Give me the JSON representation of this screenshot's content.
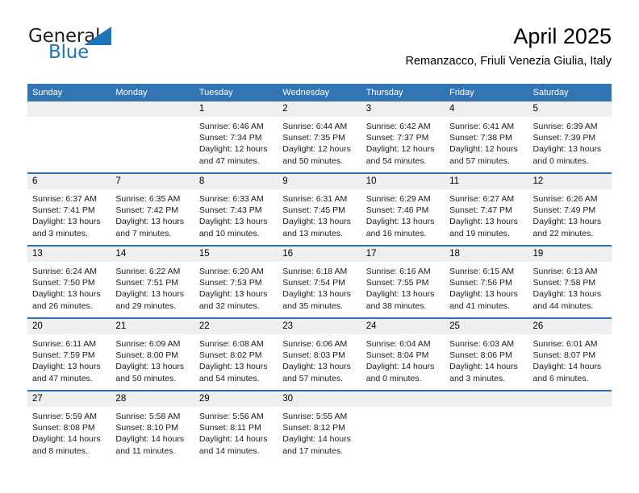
{
  "brand": {
    "name_top": "General",
    "name_bottom": "Blue",
    "triangle_icon": "brand-triangle-icon",
    "color_dark": "#231f20",
    "color_blue": "#1b76bc"
  },
  "header": {
    "title": "April 2025",
    "subtitle": "Remanzacco, Friuli Venezia Giulia, Italy"
  },
  "theme": {
    "header_blue": "#3175b4",
    "row_divider": "#2f6fae",
    "daynum_band": "#efefef",
    "cell_bg": "#ffffff"
  },
  "weekdays": [
    "Sunday",
    "Monday",
    "Tuesday",
    "Wednesday",
    "Thursday",
    "Friday",
    "Saturday"
  ],
  "weeks": [
    [
      {
        "day": "",
        "empty": true
      },
      {
        "day": "",
        "empty": true
      },
      {
        "day": "1",
        "sunrise": "Sunrise: 6:46 AM",
        "sunset": "Sunset: 7:34 PM",
        "daylight_l1": "Daylight: 12 hours",
        "daylight_l2": "and 47 minutes."
      },
      {
        "day": "2",
        "sunrise": "Sunrise: 6:44 AM",
        "sunset": "Sunset: 7:35 PM",
        "daylight_l1": "Daylight: 12 hours",
        "daylight_l2": "and 50 minutes."
      },
      {
        "day": "3",
        "sunrise": "Sunrise: 6:42 AM",
        "sunset": "Sunset: 7:37 PM",
        "daylight_l1": "Daylight: 12 hours",
        "daylight_l2": "and 54 minutes."
      },
      {
        "day": "4",
        "sunrise": "Sunrise: 6:41 AM",
        "sunset": "Sunset: 7:38 PM",
        "daylight_l1": "Daylight: 12 hours",
        "daylight_l2": "and 57 minutes."
      },
      {
        "day": "5",
        "sunrise": "Sunrise: 6:39 AM",
        "sunset": "Sunset: 7:39 PM",
        "daylight_l1": "Daylight: 13 hours",
        "daylight_l2": "and 0 minutes."
      }
    ],
    [
      {
        "day": "6",
        "sunrise": "Sunrise: 6:37 AM",
        "sunset": "Sunset: 7:41 PM",
        "daylight_l1": "Daylight: 13 hours",
        "daylight_l2": "and 3 minutes."
      },
      {
        "day": "7",
        "sunrise": "Sunrise: 6:35 AM",
        "sunset": "Sunset: 7:42 PM",
        "daylight_l1": "Daylight: 13 hours",
        "daylight_l2": "and 7 minutes."
      },
      {
        "day": "8",
        "sunrise": "Sunrise: 6:33 AM",
        "sunset": "Sunset: 7:43 PM",
        "daylight_l1": "Daylight: 13 hours",
        "daylight_l2": "and 10 minutes."
      },
      {
        "day": "9",
        "sunrise": "Sunrise: 6:31 AM",
        "sunset": "Sunset: 7:45 PM",
        "daylight_l1": "Daylight: 13 hours",
        "daylight_l2": "and 13 minutes."
      },
      {
        "day": "10",
        "sunrise": "Sunrise: 6:29 AM",
        "sunset": "Sunset: 7:46 PM",
        "daylight_l1": "Daylight: 13 hours",
        "daylight_l2": "and 16 minutes."
      },
      {
        "day": "11",
        "sunrise": "Sunrise: 6:27 AM",
        "sunset": "Sunset: 7:47 PM",
        "daylight_l1": "Daylight: 13 hours",
        "daylight_l2": "and 19 minutes."
      },
      {
        "day": "12",
        "sunrise": "Sunrise: 6:26 AM",
        "sunset": "Sunset: 7:49 PM",
        "daylight_l1": "Daylight: 13 hours",
        "daylight_l2": "and 22 minutes."
      }
    ],
    [
      {
        "day": "13",
        "sunrise": "Sunrise: 6:24 AM",
        "sunset": "Sunset: 7:50 PM",
        "daylight_l1": "Daylight: 13 hours",
        "daylight_l2": "and 26 minutes."
      },
      {
        "day": "14",
        "sunrise": "Sunrise: 6:22 AM",
        "sunset": "Sunset: 7:51 PM",
        "daylight_l1": "Daylight: 13 hours",
        "daylight_l2": "and 29 minutes."
      },
      {
        "day": "15",
        "sunrise": "Sunrise: 6:20 AM",
        "sunset": "Sunset: 7:53 PM",
        "daylight_l1": "Daylight: 13 hours",
        "daylight_l2": "and 32 minutes."
      },
      {
        "day": "16",
        "sunrise": "Sunrise: 6:18 AM",
        "sunset": "Sunset: 7:54 PM",
        "daylight_l1": "Daylight: 13 hours",
        "daylight_l2": "and 35 minutes."
      },
      {
        "day": "17",
        "sunrise": "Sunrise: 6:16 AM",
        "sunset": "Sunset: 7:55 PM",
        "daylight_l1": "Daylight: 13 hours",
        "daylight_l2": "and 38 minutes."
      },
      {
        "day": "18",
        "sunrise": "Sunrise: 6:15 AM",
        "sunset": "Sunset: 7:56 PM",
        "daylight_l1": "Daylight: 13 hours",
        "daylight_l2": "and 41 minutes."
      },
      {
        "day": "19",
        "sunrise": "Sunrise: 6:13 AM",
        "sunset": "Sunset: 7:58 PM",
        "daylight_l1": "Daylight: 13 hours",
        "daylight_l2": "and 44 minutes."
      }
    ],
    [
      {
        "day": "20",
        "sunrise": "Sunrise: 6:11 AM",
        "sunset": "Sunset: 7:59 PM",
        "daylight_l1": "Daylight: 13 hours",
        "daylight_l2": "and 47 minutes."
      },
      {
        "day": "21",
        "sunrise": "Sunrise: 6:09 AM",
        "sunset": "Sunset: 8:00 PM",
        "daylight_l1": "Daylight: 13 hours",
        "daylight_l2": "and 50 minutes."
      },
      {
        "day": "22",
        "sunrise": "Sunrise: 6:08 AM",
        "sunset": "Sunset: 8:02 PM",
        "daylight_l1": "Daylight: 13 hours",
        "daylight_l2": "and 54 minutes."
      },
      {
        "day": "23",
        "sunrise": "Sunrise: 6:06 AM",
        "sunset": "Sunset: 8:03 PM",
        "daylight_l1": "Daylight: 13 hours",
        "daylight_l2": "and 57 minutes."
      },
      {
        "day": "24",
        "sunrise": "Sunrise: 6:04 AM",
        "sunset": "Sunset: 8:04 PM",
        "daylight_l1": "Daylight: 14 hours",
        "daylight_l2": "and 0 minutes."
      },
      {
        "day": "25",
        "sunrise": "Sunrise: 6:03 AM",
        "sunset": "Sunset: 8:06 PM",
        "daylight_l1": "Daylight: 14 hours",
        "daylight_l2": "and 3 minutes."
      },
      {
        "day": "26",
        "sunrise": "Sunrise: 6:01 AM",
        "sunset": "Sunset: 8:07 PM",
        "daylight_l1": "Daylight: 14 hours",
        "daylight_l2": "and 6 minutes."
      }
    ],
    [
      {
        "day": "27",
        "sunrise": "Sunrise: 5:59 AM",
        "sunset": "Sunset: 8:08 PM",
        "daylight_l1": "Daylight: 14 hours",
        "daylight_l2": "and 8 minutes."
      },
      {
        "day": "28",
        "sunrise": "Sunrise: 5:58 AM",
        "sunset": "Sunset: 8:10 PM",
        "daylight_l1": "Daylight: 14 hours",
        "daylight_l2": "and 11 minutes."
      },
      {
        "day": "29",
        "sunrise": "Sunrise: 5:56 AM",
        "sunset": "Sunset: 8:11 PM",
        "daylight_l1": "Daylight: 14 hours",
        "daylight_l2": "and 14 minutes."
      },
      {
        "day": "30",
        "sunrise": "Sunrise: 5:55 AM",
        "sunset": "Sunset: 8:12 PM",
        "daylight_l1": "Daylight: 14 hours",
        "daylight_l2": "and 17 minutes."
      },
      {
        "day": "",
        "empty": true
      },
      {
        "day": "",
        "empty": true
      },
      {
        "day": "",
        "empty": true
      }
    ]
  ]
}
